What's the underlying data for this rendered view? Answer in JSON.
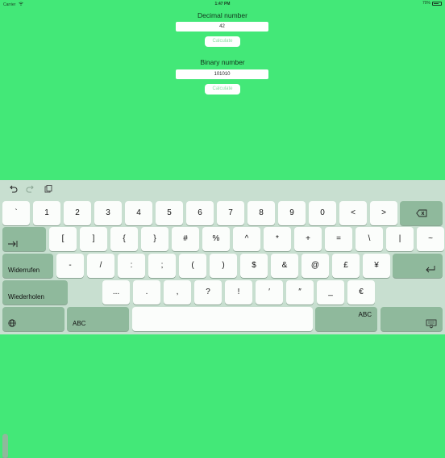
{
  "status_bar": {
    "carrier": "Carrier",
    "time": "1:47 PM",
    "battery": "70%",
    "battery_level": 0.7
  },
  "decimal": {
    "label": "Decimal number",
    "value": "42",
    "button": "Calculate"
  },
  "binary": {
    "label": "Binary number",
    "value": "101010",
    "button": "Calculate"
  },
  "keyboard": {
    "row1": [
      "`",
      "1",
      "2",
      "3",
      "4",
      "5",
      "6",
      "7",
      "8",
      "9",
      "0",
      "<",
      ">"
    ],
    "row2": [
      "[",
      "]",
      "{",
      "}",
      "#",
      "%",
      "^",
      "*",
      "+",
      "=",
      "\\",
      "|",
      "~"
    ],
    "row3": [
      "-",
      "/",
      ":",
      ";",
      "(",
      ")",
      "$",
      "&",
      "@",
      "£",
      "¥"
    ],
    "row4": [
      "...",
      ".",
      ",",
      "?",
      "!",
      "′",
      "″",
      "_",
      "€"
    ],
    "undo_label": "Widerrufen",
    "redo_label": "Wiederholen",
    "abc_left": "ABC",
    "abc_right": "ABC"
  }
}
